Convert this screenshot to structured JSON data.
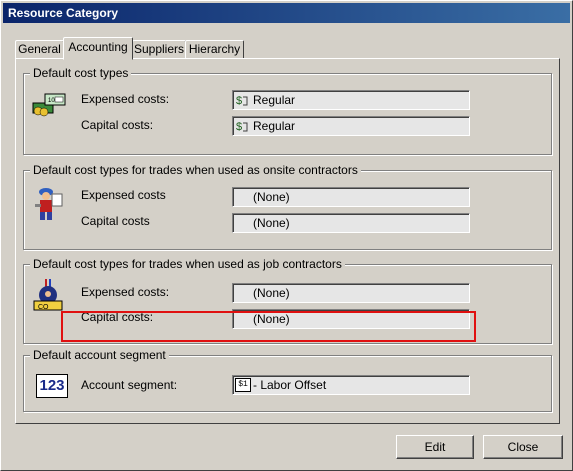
{
  "window": {
    "title": "Resource Category"
  },
  "tabs": [
    {
      "label": "General",
      "active": false
    },
    {
      "label": "Accounting",
      "active": true
    },
    {
      "label": "Suppliers",
      "active": false
    },
    {
      "label": "Hierarchy",
      "active": false
    }
  ],
  "groups": {
    "default_cost_types": {
      "label": "Default cost types",
      "expensed_label": "Expensed costs:",
      "expensed_value": "Regular",
      "capital_label": "Capital costs:",
      "capital_value": "Regular"
    },
    "onsite_contractors": {
      "label": "Default cost types for trades when used as onsite contractors",
      "expensed_label": "Expensed costs",
      "expensed_value": "(None)",
      "capital_label": "Capital costs",
      "capital_value": "(None)"
    },
    "job_contractors": {
      "label": "Default cost types for trades when used as job contractors",
      "expensed_label": "Expensed costs:",
      "expensed_value": "(None)",
      "capital_label": "Capital costs:",
      "capital_value": "(None)"
    },
    "account_segment": {
      "label": "Default account segment",
      "icon_text": "123",
      "segment_label": "Account segment:",
      "segment_icon_text": "$1",
      "segment_value": "- Labor Offset"
    }
  },
  "buttons": {
    "edit": "Edit",
    "close": "Close"
  },
  "colors": {
    "title_bar": "#0a246a",
    "highlight": "#e01010",
    "face": "#d4d0c8"
  }
}
